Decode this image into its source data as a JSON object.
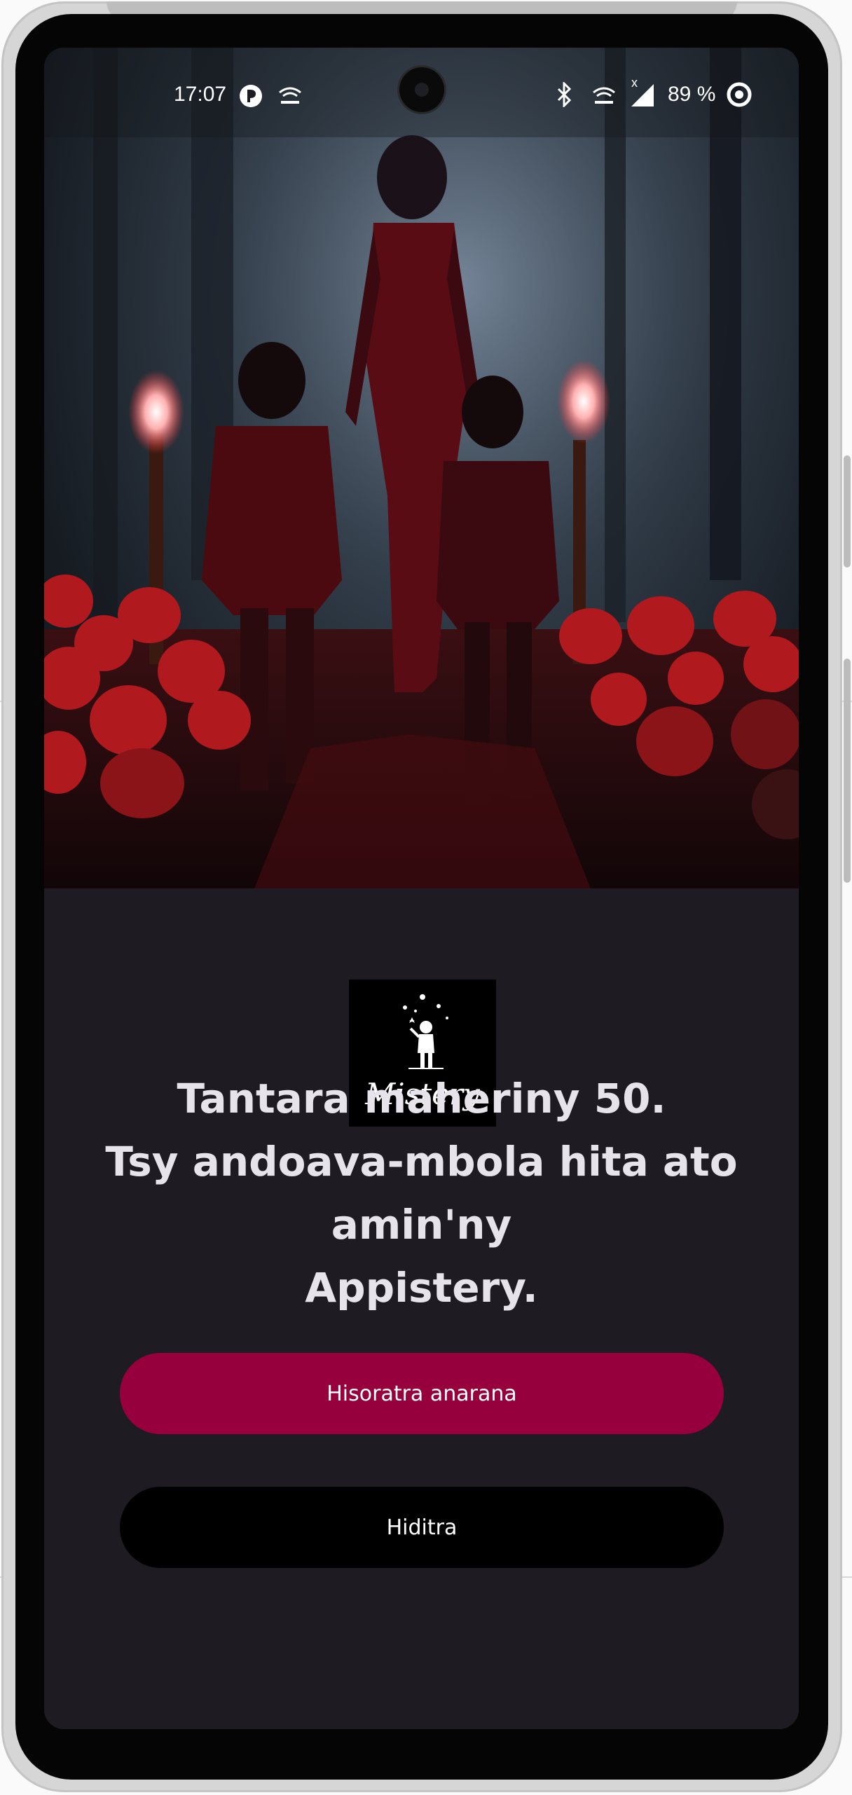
{
  "status_bar": {
    "time": "17:07",
    "battery": "89 %",
    "left_icons": [
      "notification-app-icon",
      "hotspot-icon"
    ],
    "right_icons": [
      "bluetooth-icon",
      "hotspot-icon",
      "signal-icon",
      "battery-icon"
    ],
    "signal_marker": "x"
  },
  "hero": {
    "image_name": "horror-story-illustration"
  },
  "logo": {
    "text": "Mistery"
  },
  "headline": {
    "line1": "Tantara maheriny 50.",
    "line2": "Tsy andoava-mbola hita ato amin'ny",
    "line3": "Appistery."
  },
  "buttons": {
    "register_label": "Hisoratra anarana",
    "login_label": "Hiditra"
  },
  "colors": {
    "screen_background": "#1e1b22",
    "primary_button": "#96003c",
    "secondary_button": "#000000",
    "headline_text": "#e7e3ea"
  }
}
